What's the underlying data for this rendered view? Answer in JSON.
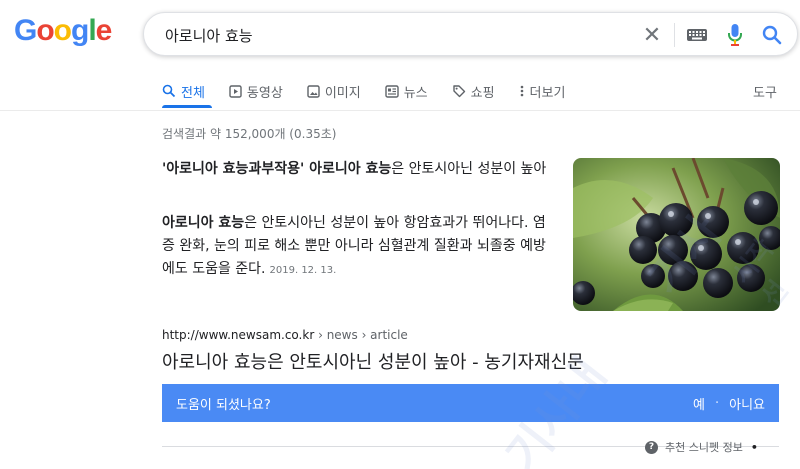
{
  "logo": {
    "letters": [
      "G",
      "o",
      "o",
      "g",
      "l",
      "e"
    ],
    "colors": [
      "#4285f4",
      "#ea4335",
      "#fbbc05",
      "#4285f4",
      "#34a853",
      "#ea4335"
    ]
  },
  "search": {
    "query": "아로니아 효능"
  },
  "tabs": [
    {
      "label": "전체",
      "icon": "search-icon",
      "active": true
    },
    {
      "label": "동영상",
      "icon": "video-icon"
    },
    {
      "label": "이미지",
      "icon": "image-icon"
    },
    {
      "label": "뉴스",
      "icon": "news-icon"
    },
    {
      "label": "쇼핑",
      "icon": "tag-icon"
    },
    {
      "label": "더보기",
      "icon": "more-vert-icon"
    }
  ],
  "tools_label": "도구",
  "stats": "검색결과 약 152,000개 (0.35초)",
  "snippet": {
    "title_part1": "'아로니아 효능과부작용'",
    "title_part2": " 아로니아 효능",
    "title_part3": "은 안토시아닌 성분이 높아",
    "body_bold": "아로니아 효능",
    "body_text": "은 안토시아닌 성분이 높아 항암효과가 뛰어나다. 염증 완화, 눈의 피로 해소 뿐만 아니라 심혈관계 질환과 뇌졸중 예방에도 도움을 준다.",
    "date": "2019. 12. 13."
  },
  "result": {
    "url_base": "http://www.newsam.co.kr",
    "url_crumb": " › news › article",
    "title": "아로니아 효능은 안토시아닌 성분이 높아 - 농기자재신문"
  },
  "feedback": {
    "question": "도움이 되셨나요?",
    "yes": "예",
    "dot": "·",
    "no": "아니요",
    "bar_color": "#4a8af4"
  },
  "about": {
    "label": "추천 스니펫 정보",
    "more": "•"
  },
  "watermarks": [
    "기사",
    "기사내",
    "시작선"
  ]
}
